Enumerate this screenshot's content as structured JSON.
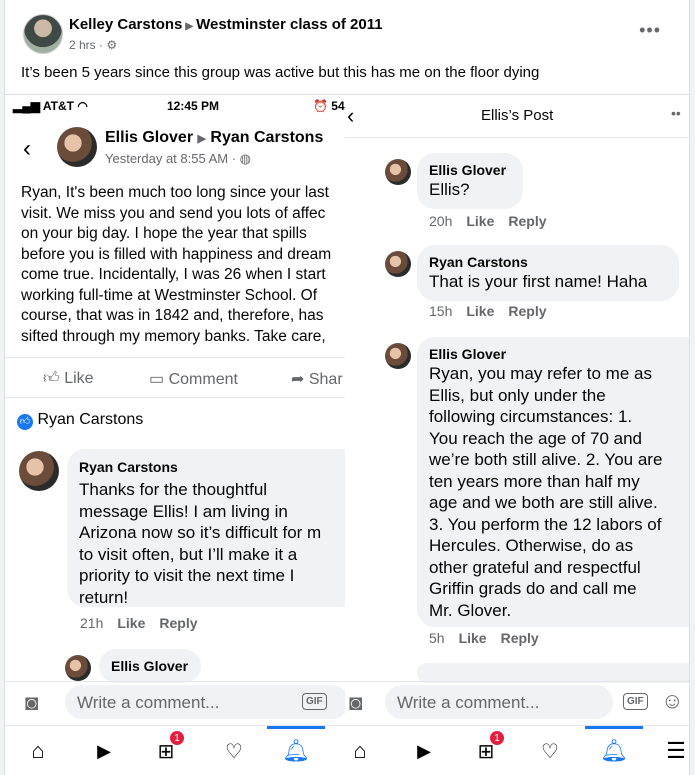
{
  "post": {
    "author": "Kelley Carstons",
    "group": "Westminster class of 2011",
    "time": "2 hrs",
    "privacy_separator": "·",
    "text": "It’s been 5 years since this group was active but this has me on the floor dying"
  },
  "left": {
    "status_carrier": "AT&T",
    "status_time": "12:45 PM",
    "status_battery": "54",
    "post_from": "Ellis Glover",
    "post_to": "Ryan Carstons",
    "post_time": "Yesterday at 8:55 AM ·",
    "lines": [
      "Ryan, It's been much too long since your last",
      "visit. We miss you and send you lots of affec",
      "on your big day. I hope the year that spills",
      "before you is filled with happiness and dream",
      "come true. Incidentally, I was 26 when I start",
      "working full-time at Westminster School. Of",
      "course, that was in 1842 and, therefore, has",
      "sifted through my memory banks. Take care,"
    ],
    "like": "Like",
    "comment": "Comment",
    "share": "Shar",
    "liked_by": "Ryan Carstons",
    "reply_name": "Ryan Carstons",
    "reply_lines": [
      "Thanks for the thoughtful",
      "message Ellis! I am living in",
      "Arizona now so it’s difficult for m",
      "to visit often, but I’ll make it a",
      "priority to visit the next time I",
      "return!"
    ],
    "reply_time": "21h",
    "reply_like": "Like",
    "reply_reply": "Reply",
    "next_name": "Ellis Glover",
    "write_comment": "Write a comment...",
    "gif": "GIF",
    "badge": "1"
  },
  "right": {
    "title": "Ellis’s Post",
    "c1_name": "Ellis Glover",
    "c1_text": "Ellis?",
    "c1_time": "20h",
    "c2_name": "Ryan Carstons",
    "c2_text": "That is your first name! Haha",
    "c2_time": "15h",
    "c3_name": "Ellis Glover",
    "c3_lines": [
      "Ryan, you may refer to me as",
      "Ellis, but only under the",
      "following circumstances: 1.",
      "You reach the age of 70 and",
      "we’re both still alive. 2. You are",
      "ten years more than half my",
      "age and we both are still alive.",
      "3. You perform the 12 labors of",
      "Hercules. Otherwise, do as",
      "other grateful and respectful",
      "Griffin grads do and call me",
      "Mr. Glover."
    ],
    "c3_time": "5h",
    "like": "Like",
    "reply": "Reply",
    "write_comment": "Write a comment...",
    "gif": "GIF",
    "badge": "1"
  }
}
